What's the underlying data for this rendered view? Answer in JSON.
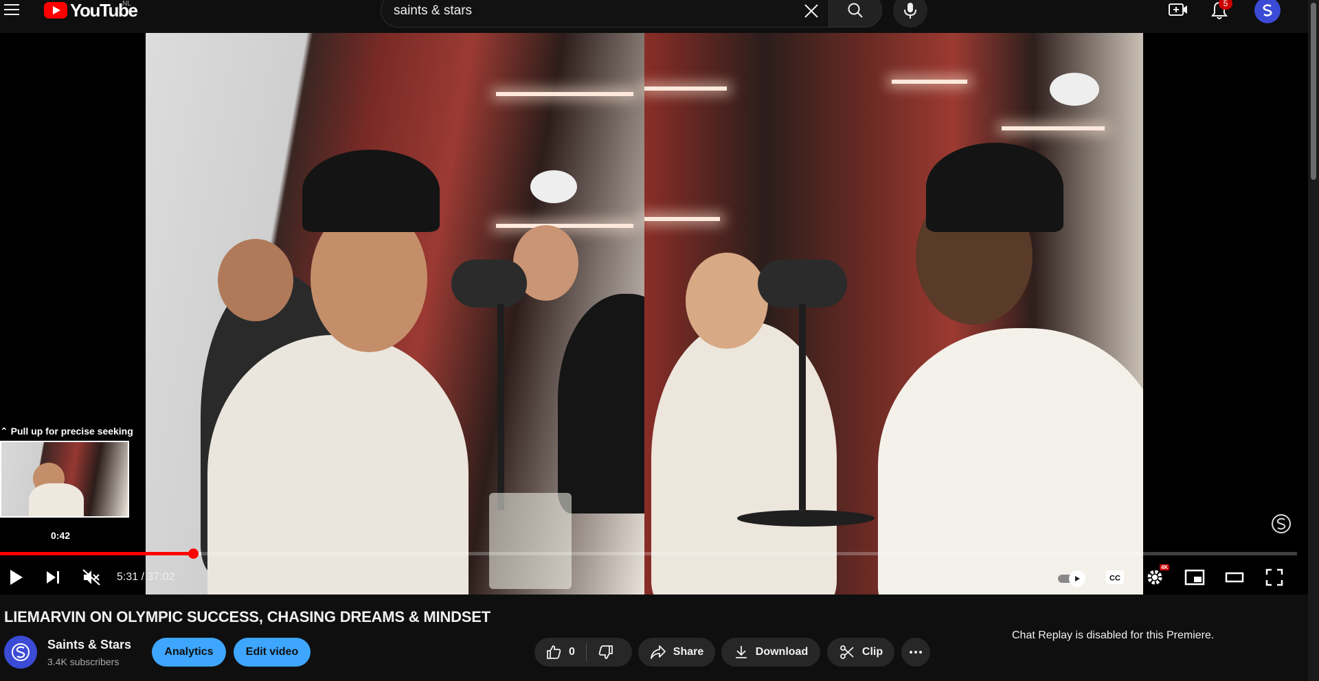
{
  "header": {
    "logo_text": "YouTube",
    "country_code": "NL",
    "search_value": "saints & stars",
    "notification_count": "5"
  },
  "player": {
    "preview_hint": "Pull up for precise seeking",
    "preview_time": "0:42",
    "current_time": "5:31",
    "duration": "37:02",
    "time_display": "5:31 / 37:02",
    "played_fraction": 0.149,
    "loaded_fraction": 0.155,
    "quality_badge": "4K",
    "muted": true
  },
  "video": {
    "title": "LIEMARVIN ON OLYMPIC SUCCESS, CHASING DREAMS & MINDSET"
  },
  "channel": {
    "name": "Saints & Stars",
    "subscribers": "3.4K subscribers"
  },
  "actions": {
    "analytics_label": "Analytics",
    "edit_label": "Edit video",
    "like_count": "0",
    "share_label": "Share",
    "download_label": "Download",
    "clip_label": "Clip"
  },
  "chat": {
    "message": "Chat Replay is disabled for this Premiere."
  },
  "colors": {
    "accent": "#ff0000",
    "button_blue": "#3ea6ff",
    "channel_avatar": "#3b4bd6"
  },
  "icons": [
    "menu-icon",
    "youtube-logo-icon",
    "clear-icon",
    "search-icon",
    "mic-icon",
    "create-icon",
    "bell-icon",
    "play-icon",
    "next-icon",
    "muted-icon",
    "autoplay-icon",
    "cc-icon",
    "settings-icon",
    "miniplayer-icon",
    "theater-icon",
    "fullscreen-icon",
    "like-icon",
    "dislike-icon",
    "share-icon",
    "download-icon",
    "scissors-icon",
    "more-icon"
  ]
}
